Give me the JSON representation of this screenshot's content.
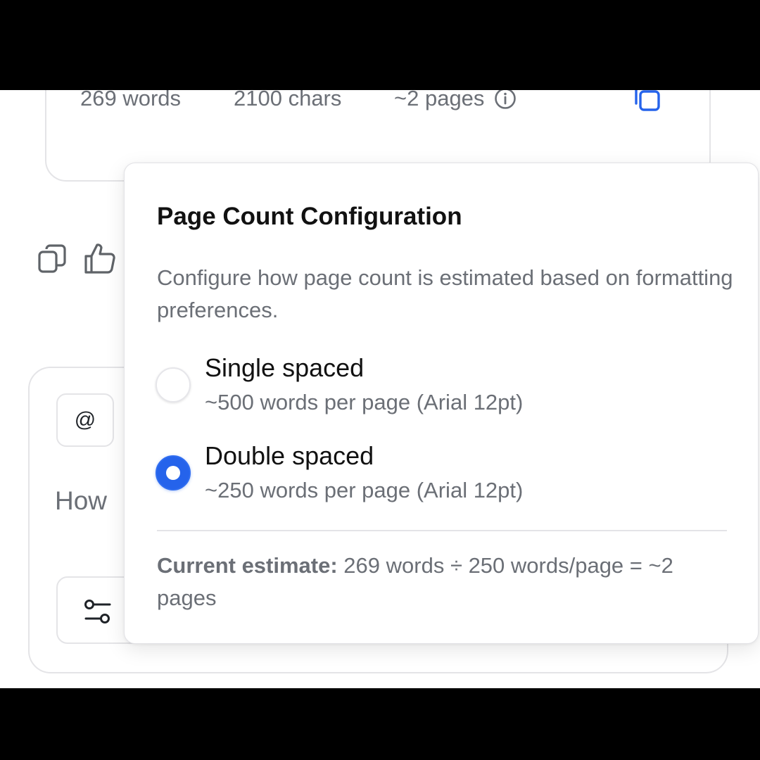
{
  "stats": {
    "words": "269 words",
    "chars": "2100 chars",
    "pages": "~2 pages",
    "info_icon": "info-circle-icon",
    "copy_icon": "copy-icon"
  },
  "actions": {
    "copy_icon": "copy-icon",
    "like_icon": "thumbs-up-icon"
  },
  "composer": {
    "mention_label": "@",
    "text_visible": "How",
    "tools_icon": "sliders-icon"
  },
  "popover": {
    "title": "Page Count Configuration",
    "description": "Configure how page count is estimated based on formatting preferences.",
    "options": [
      {
        "label": "Single spaced",
        "sub": "~500 words per page (Arial 12pt)",
        "selected": false
      },
      {
        "label": "Double spaced",
        "sub": "~250 words per page (Arial 12pt)",
        "selected": true
      }
    ],
    "estimate_label": "Current estimate:",
    "estimate_value": " 269 words ÷ 250 words/page = ~2 pages"
  },
  "colors": {
    "accent": "#2563eb",
    "muted_text": "#6b6f76",
    "border": "#e4e4e7"
  }
}
